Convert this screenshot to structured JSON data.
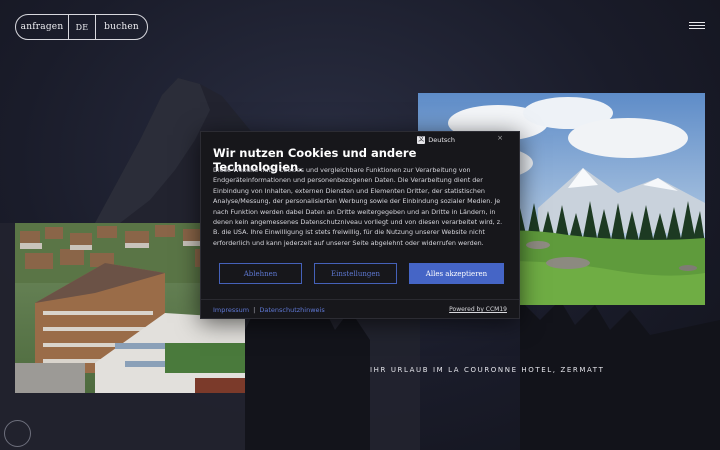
{
  "nav": {
    "anfragen": "anfragen",
    "language": "DE",
    "buchen": "buchen"
  },
  "hero": {
    "tagline": "IHR URLAUB IM LA COURONNE HOTEL, ZERMATT"
  },
  "cookie_banner": {
    "language_label": "Deutsch",
    "title": "Wir nutzen Cookies und andere Technologien.",
    "body": "Diese Website nutzt Cookies und vergleichbare Funktionen zur Verarbeitung von Endgeräteinformationen und personenbezogenen Daten. Die Verarbeitung dient der Einbindung von Inhalten, externen Diensten und Elementen Dritter, der statistischen Analyse/Messung, der personalisierten Werbung sowie der Einbindung sozialer Medien. Je nach Funktion werden dabei Daten an Dritte weitergegeben und an Dritte in Ländern, in denen kein angemessenes Datenschutzniveau vorliegt und von diesen verarbeitet wird, z. B. die USA. Ihre Einwilligung ist stets freiwillig, für die Nutzung unserer Website nicht erforderlich und kann jederzeit auf unserer Seite abgelehnt oder widerrufen werden.",
    "buttons": {
      "reject": "Ablehnen",
      "settings": "Einstellungen",
      "accept_all": "Alles akzeptieren"
    },
    "footer": {
      "impressum": "Impressum",
      "separator": "|",
      "privacy": "Datenschutzhinweis",
      "powered_by": "Powered by CCM19"
    }
  },
  "colors": {
    "background": "#161824",
    "accent_blue": "#4565c6",
    "modal_bg": "#17171b"
  },
  "icons": [
    "globe-icon",
    "close-icon",
    "menu-icon"
  ]
}
